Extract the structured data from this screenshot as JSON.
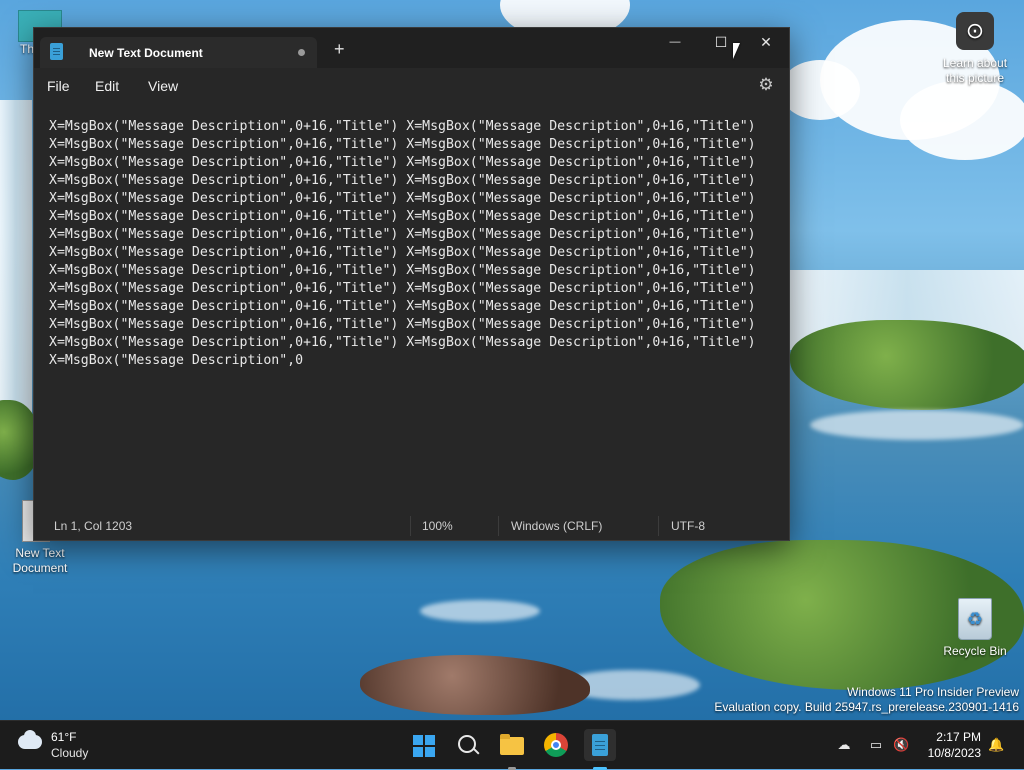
{
  "desktop": {
    "icons": [
      {
        "label": "Th"
      },
      {
        "label": "New Text Document"
      },
      {
        "label": "Recycle Bin"
      },
      {
        "label": "Learn about this picture"
      }
    ],
    "watermark": {
      "line1": "Windows 11 Pro Insider Preview",
      "line2": "Evaluation copy. Build 25947.rs_prerelease.230901-1416"
    }
  },
  "notepad": {
    "tab_title": "New Text Document",
    "new_tab": "+",
    "controls": {
      "minimize": "—",
      "maximize": "☐",
      "close": "✕"
    },
    "menu": [
      "File",
      "Edit",
      "View"
    ],
    "settings_icon": "gear-icon",
    "content_lines": [
      "X=MsgBox(\"Message Description\",0+16,\"Title\") X=MsgBox(\"Message Description\",0+16,\"Title\")",
      "X=MsgBox(\"Message Description\",0+16,\"Title\") X=MsgBox(\"Message Description\",0+16,\"Title\")",
      "X=MsgBox(\"Message Description\",0+16,\"Title\") X=MsgBox(\"Message Description\",0+16,\"Title\")",
      "X=MsgBox(\"Message Description\",0+16,\"Title\") X=MsgBox(\"Message Description\",0+16,\"Title\")",
      "X=MsgBox(\"Message Description\",0+16,\"Title\") X=MsgBox(\"Message Description\",0+16,\"Title\")",
      "X=MsgBox(\"Message Description\",0+16,\"Title\") X=MsgBox(\"Message Description\",0+16,\"Title\")",
      "X=MsgBox(\"Message Description\",0+16,\"Title\") X=MsgBox(\"Message Description\",0+16,\"Title\")",
      "X=MsgBox(\"Message Description\",0+16,\"Title\") X=MsgBox(\"Message Description\",0+16,\"Title\")",
      "X=MsgBox(\"Message Description\",0+16,\"Title\") X=MsgBox(\"Message Description\",0+16,\"Title\")",
      "X=MsgBox(\"Message Description\",0+16,\"Title\") X=MsgBox(\"Message Description\",0+16,\"Title\")",
      "X=MsgBox(\"Message Description\",0+16,\"Title\") X=MsgBox(\"Message Description\",0+16,\"Title\")",
      "X=MsgBox(\"Message Description\",0+16,\"Title\") X=MsgBox(\"Message Description\",0+16,\"Title\")",
      "X=MsgBox(\"Message Description\",0+16,\"Title\") X=MsgBox(\"Message Description\",0+16,\"Title\")",
      "X=MsgBox(\"Message Description\",0"
    ],
    "status": {
      "position": "Ln 1, Col 1203",
      "zoom": "100%",
      "line_ending": "Windows (CRLF)",
      "encoding": "UTF-8"
    }
  },
  "taskbar": {
    "weather": {
      "temp": "61°F",
      "desc": "Cloudy"
    },
    "apps": [
      "start-icon",
      "search-icon",
      "file-explorer-icon",
      "chrome-icon",
      "notepad-icon"
    ],
    "clock": {
      "time": "2:17 PM",
      "date": "10/8/2023"
    }
  }
}
